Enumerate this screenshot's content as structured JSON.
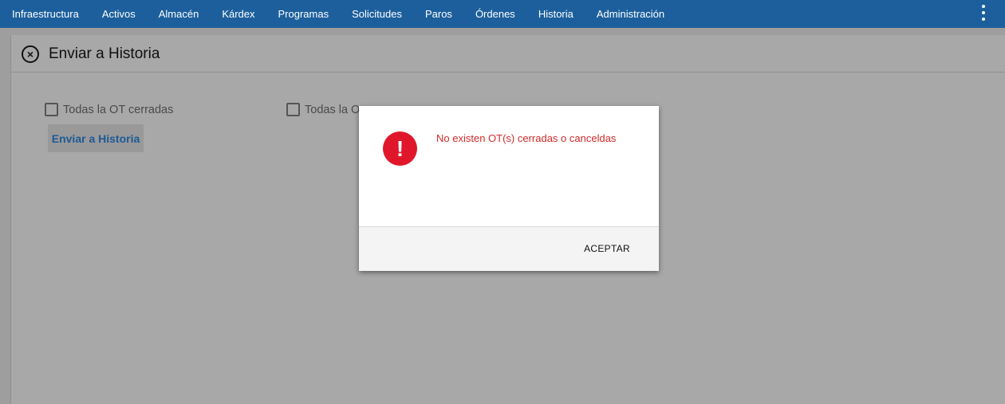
{
  "nav": {
    "items": [
      "Infraestructura",
      "Activos",
      "Almacén",
      "Kárdex",
      "Programas",
      "Solicitudes",
      "Paros",
      "Órdenes",
      "Historia",
      "Administración"
    ],
    "menu_icon": "more-vertical-icon"
  },
  "panel": {
    "close_icon": "close-circle-icon",
    "title": "Enviar a Historia",
    "checkbox1_label": "Todas la OT cerradas",
    "checkbox2_label": "Todas la O",
    "send_button": "Enviar a Historia"
  },
  "dialog": {
    "icon": "alert-icon",
    "message": "No existen OT(s) cerradas o canceldas",
    "accept_label": "ACEPTAR"
  },
  "colors": {
    "topbar": "#1c5f9c",
    "alert": "#e0172a",
    "message": "#d12a2a"
  }
}
